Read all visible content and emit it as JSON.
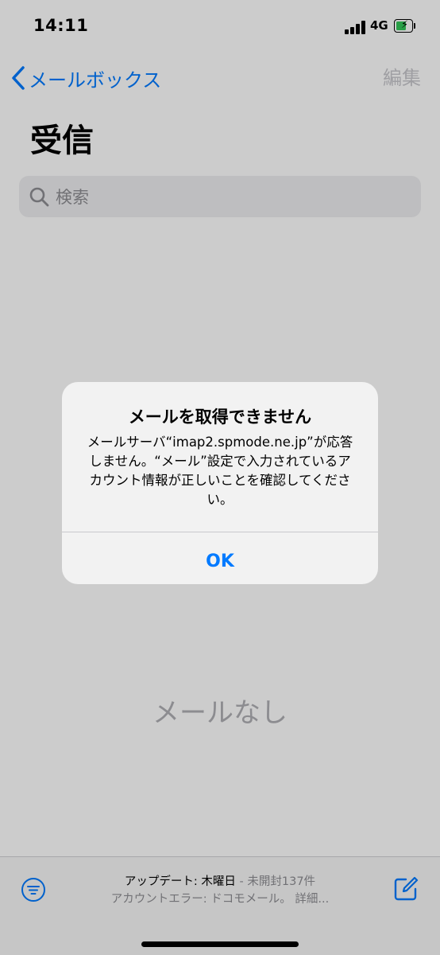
{
  "status_bar": {
    "time": "14:11",
    "network": "4G",
    "battery_state": "charging"
  },
  "nav": {
    "back_label": "メールボックス",
    "edit_label": "編集",
    "title": "受信"
  },
  "search": {
    "placeholder": "検索"
  },
  "empty_state": "メールなし",
  "alert": {
    "title": "メールを取得できません",
    "message": "メールサーバ“imap2.spmode.ne.jp”が応答しません。“メール”設定で入力されているアカウント情報が正しいことを確認してください。",
    "ok_label": "OK"
  },
  "toolbar": {
    "updated": "アップデート: 木曜日",
    "unread": " - 未開封137件",
    "account_error": "アカウントエラー: ドコモメール。 詳細..."
  },
  "colors": {
    "accent": "#007aff",
    "battery": "#34c759"
  }
}
